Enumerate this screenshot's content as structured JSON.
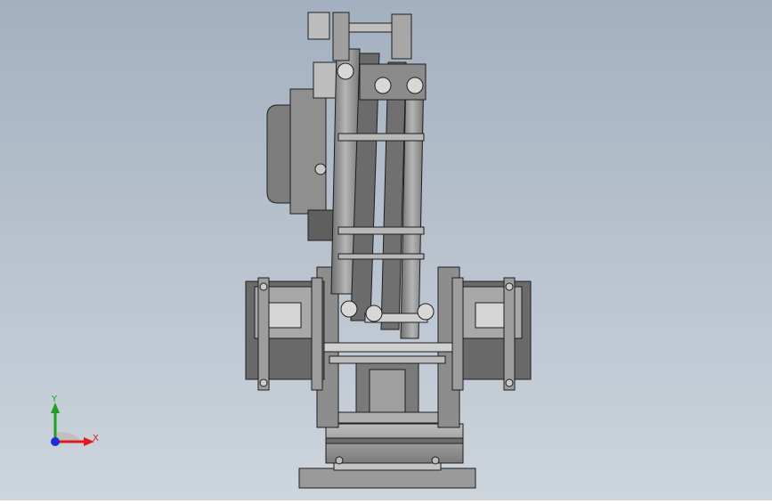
{
  "viewport": {
    "background_top": "#a9b6c4",
    "background_bottom": "#c9d2db",
    "model_fill": "#8c8c8c",
    "model_dark": "#5e5e5e",
    "model_light": "#c8c8c8",
    "edge": "#1e1e1e"
  },
  "triad": {
    "x_label": "X",
    "y_label": "Y",
    "x_color": "#e01b1b",
    "y_color": "#1fa01f",
    "z_color": "#1c2fd6"
  }
}
